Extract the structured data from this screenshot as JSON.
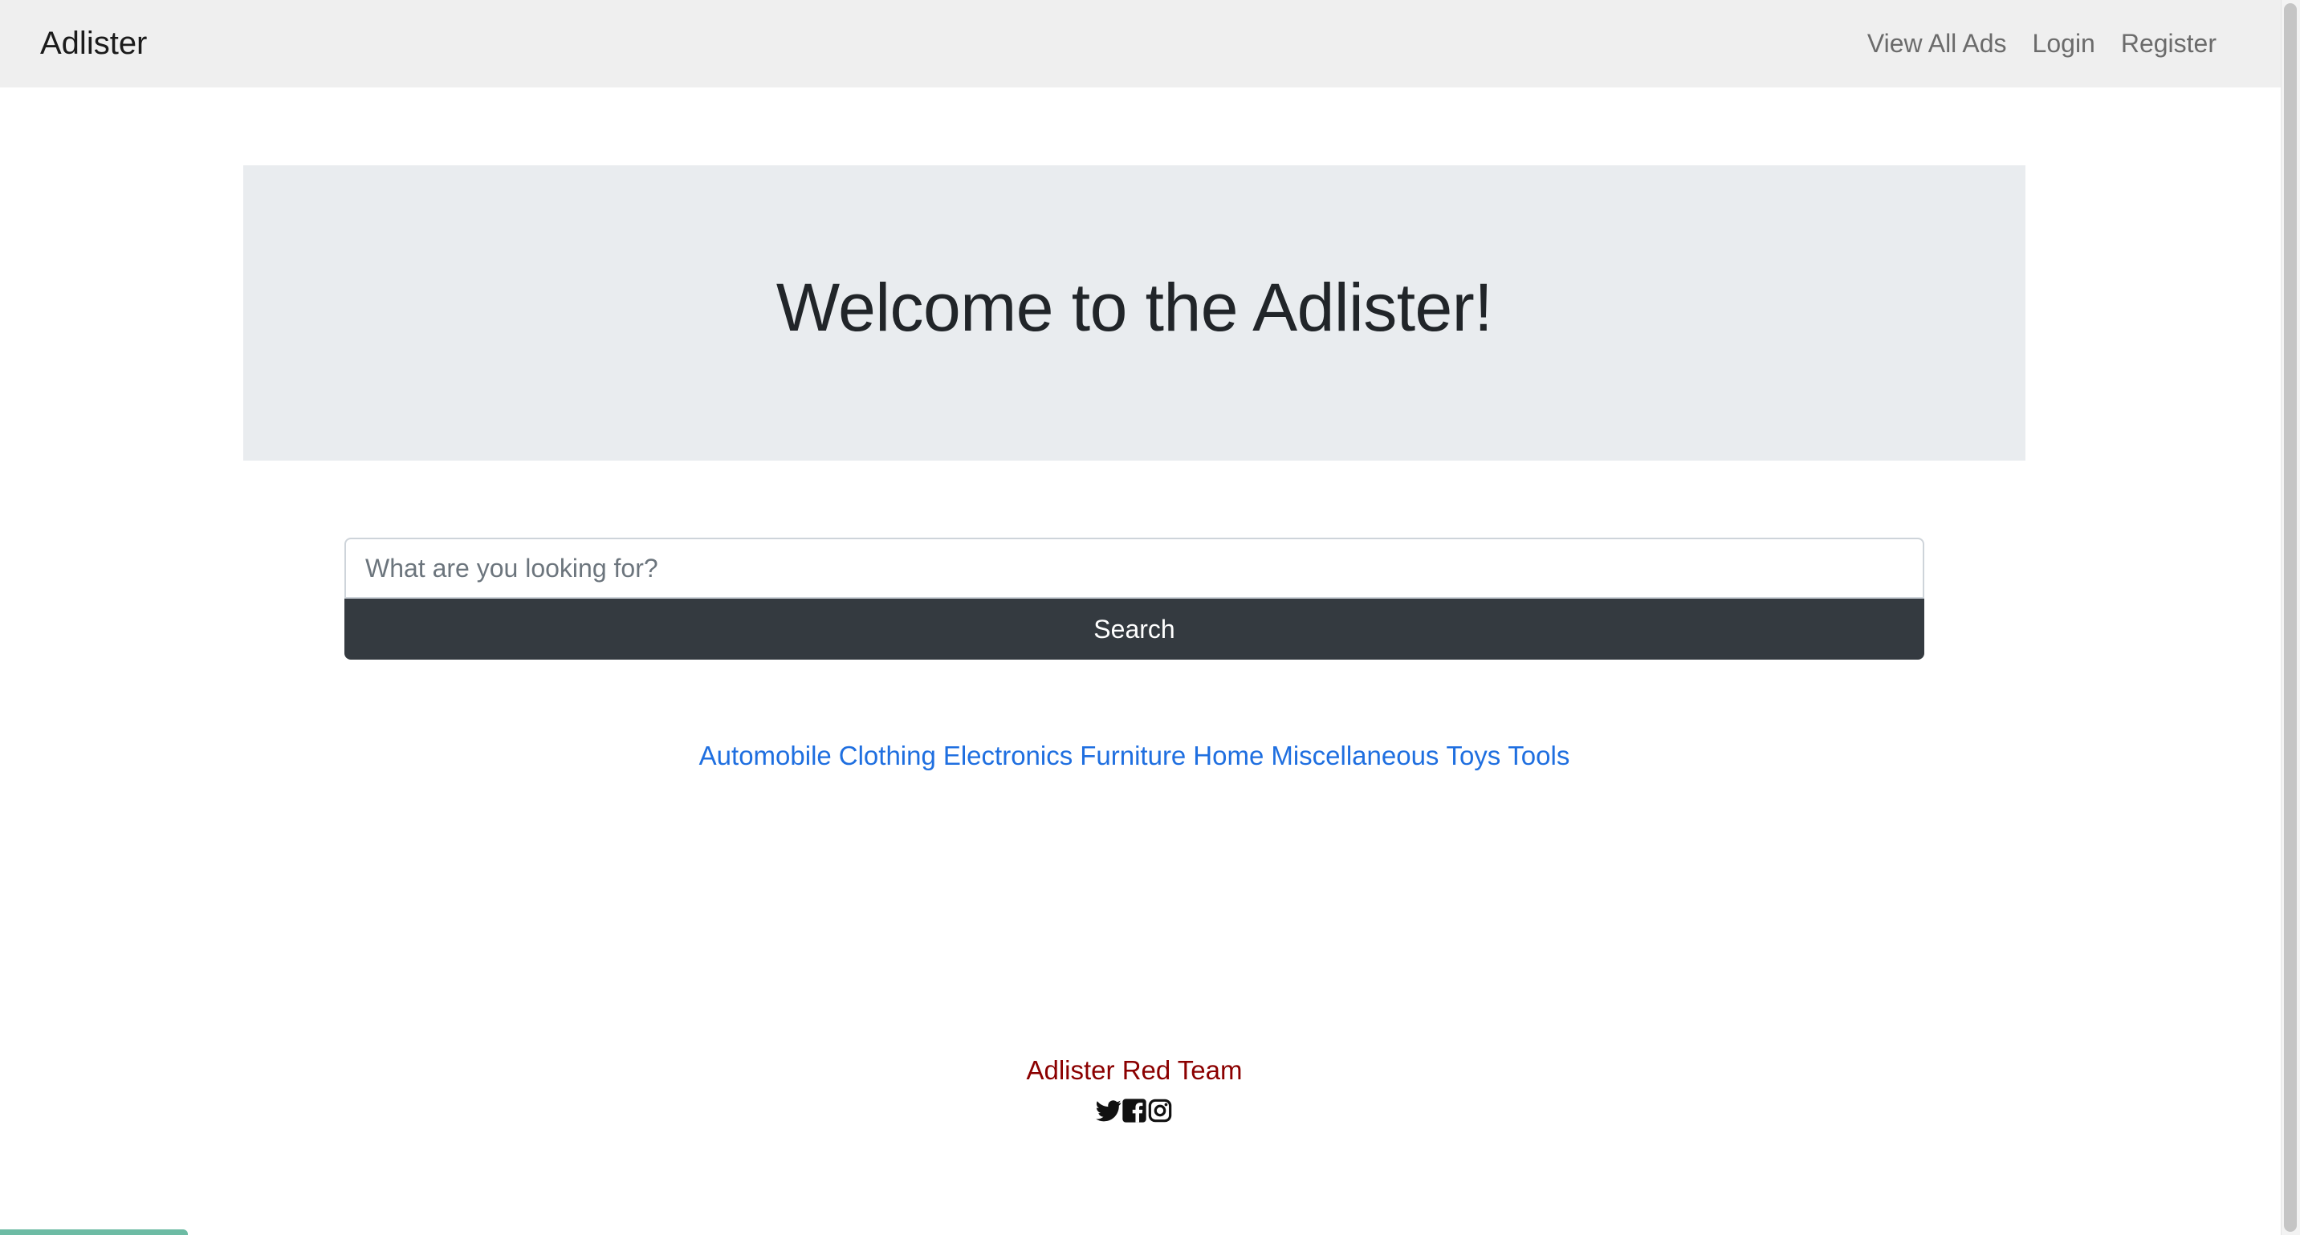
{
  "navbar": {
    "brand": "Adlister",
    "links": [
      "View All Ads",
      "Login",
      "Register"
    ]
  },
  "hero": {
    "title": "Welcome to the Adlister!"
  },
  "search": {
    "placeholder": "What are you looking for?",
    "value": "",
    "button_label": "Search"
  },
  "categories": [
    "Automobile",
    "Clothing",
    "Electronics",
    "Furniture",
    "Home",
    "Miscellaneous",
    "Toys",
    "Tools"
  ],
  "footer": {
    "title": "Adlister Red Team",
    "icons": [
      "twitter-icon",
      "facebook-icon",
      "instagram-icon"
    ]
  },
  "colors": {
    "navbar_bg": "#efefef",
    "jumbotron_bg": "#e9ecef",
    "button_bg": "#343a40",
    "link": "#1f6fe0",
    "footer_title": "#8b0000",
    "progress": "#6dbba4"
  }
}
